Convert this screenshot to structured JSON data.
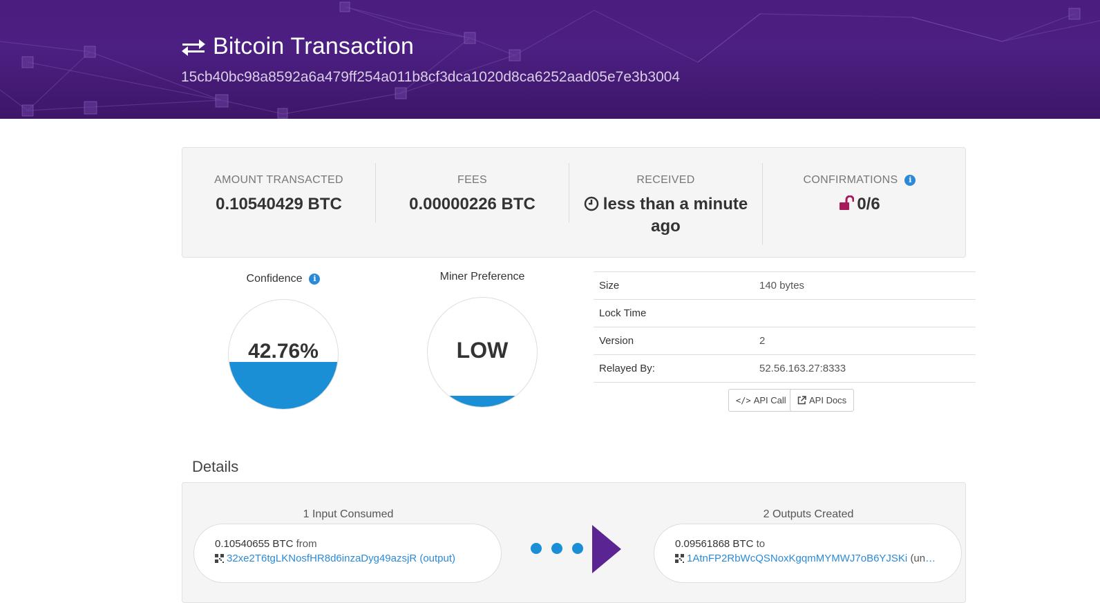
{
  "header": {
    "title": "Bitcoin Transaction",
    "hash": "15cb40bc98a8592a6a479ff254a011b8cf3dca1020d8ca6252aad05e7e3b3004",
    "bg_color": "#4a1d7e"
  },
  "summary": {
    "amount_label": "AMOUNT TRANSACTED",
    "amount_value": "0.10540429 BTC",
    "fees_label": "FEES",
    "fees_value": "0.00000226 BTC",
    "received_label": "RECEIVED",
    "received_value": "less than a minute ago",
    "confirmations_label": "CONFIRMATIONS",
    "confirmations_value": "0/6",
    "confirmations_color": "#a8195a"
  },
  "gauges": {
    "confidence_label": "Confidence",
    "confidence_value": "42.76%",
    "confidence_fill_fraction": 0.4276,
    "miner_label": "Miner Preference",
    "miner_value": "LOW",
    "miner_fill_fraction": 0.1,
    "fill_color": "#1b8fd6"
  },
  "info": {
    "rows": [
      {
        "label": "Size",
        "value": "140 bytes"
      },
      {
        "label": "Lock Time",
        "value": ""
      },
      {
        "label": "Version",
        "value": "2"
      },
      {
        "label": "Relayed By:",
        "value": "52.56.163.27:8333"
      }
    ],
    "api_call_label": "API Call",
    "api_docs_label": "API Docs"
  },
  "details": {
    "title": "Details",
    "inputs_title": "1 Input Consumed",
    "outputs_title": "2 Outputs Created",
    "input": {
      "amount": "0.10540655 BTC",
      "direction": "from",
      "address": "32xe2T6tgLKNosfHR8d6inzaDyg49azsjR",
      "note": "(output)"
    },
    "output": {
      "amount": "0.09561868 BTC",
      "direction": "to",
      "address": "1AtnFP2RbWcQSNoxKgqmMYMWJ7oB6YJSKi",
      "note": "(unsp…"
    }
  }
}
